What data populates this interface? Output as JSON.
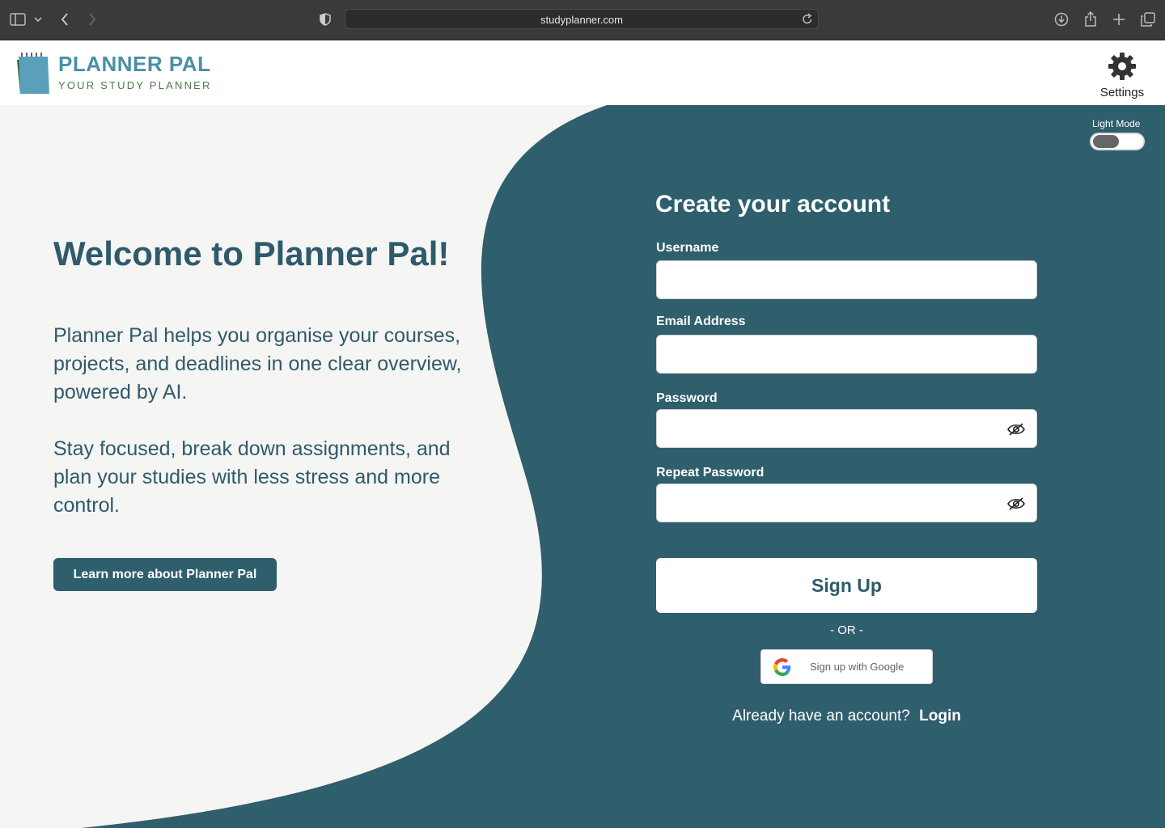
{
  "browser": {
    "url": "studyplanner.com"
  },
  "brand": {
    "name": "PLANNER PAL",
    "tagline": "YOUR STUDY PLANNER"
  },
  "header": {
    "settings_label": "Settings"
  },
  "theme": {
    "mode_label": "Light Mode",
    "primary": "#2f5e6d",
    "background": "#f5f5f3"
  },
  "welcome": {
    "title": "Welcome to Planner Pal!",
    "paragraph1": "Planner Pal helps you organise your courses, projects, and deadlines in one clear overview, powered by AI.",
    "paragraph2": "Stay focused, break down assignments, and plan your studies with less stress and more control.",
    "learn_more_label": "Learn more about Planner Pal"
  },
  "form": {
    "title": "Create your account",
    "username_label": "Username",
    "email_label": "Email Address",
    "password_label": "Password",
    "repeat_password_label": "Repeat Password",
    "signup_label": "Sign Up",
    "or_label": "-  OR -",
    "google_label": "Sign up with Google",
    "already_text": "Already have an account?",
    "login_label": "Login"
  }
}
